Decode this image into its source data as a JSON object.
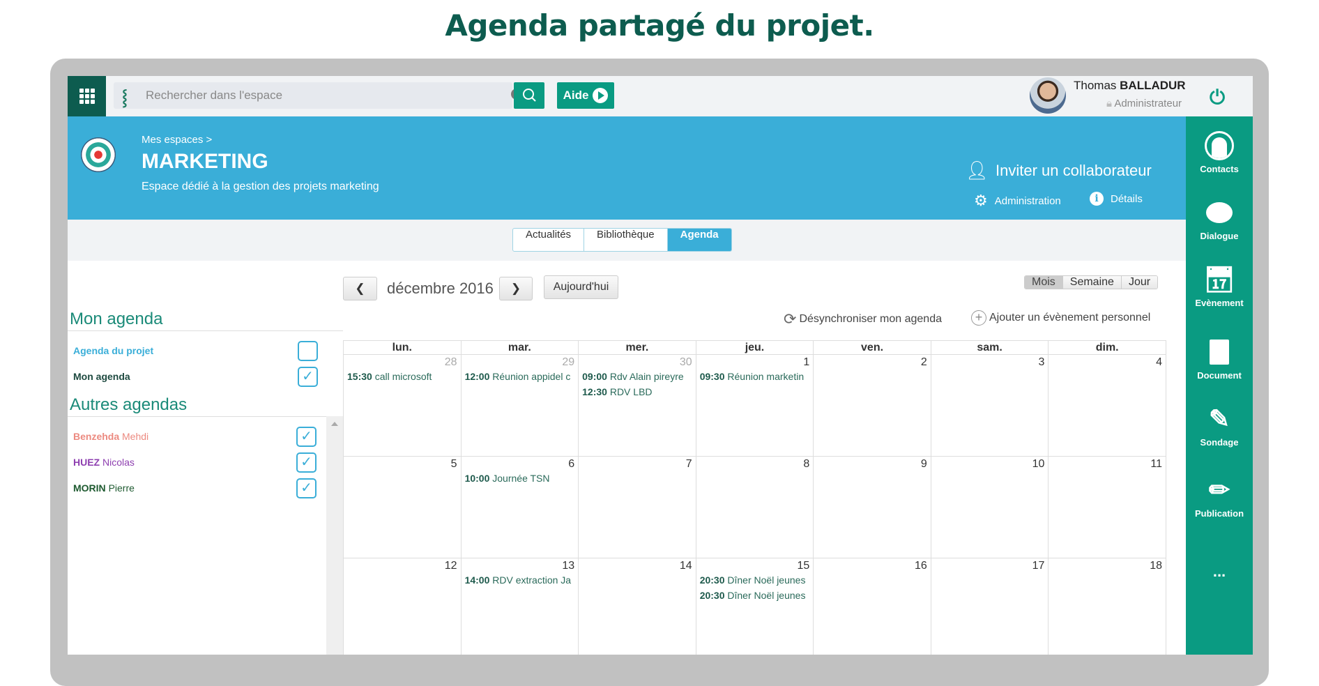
{
  "page_title": "Agenda partagé du projet.",
  "topbar": {
    "search_placeholder": "Rechercher dans l'espace",
    "help_label": "Aide",
    "user_first": "Thomas",
    "user_last": "BALLADUR",
    "user_role": "Administrateur"
  },
  "header": {
    "breadcrumb": "Mes espaces >",
    "space_name": "MARKETING",
    "space_desc": "Espace dédié à la gestion des projets marketing",
    "invite": "Inviter un collaborateur",
    "admin": "Administration",
    "details": "Détails"
  },
  "tabs": [
    {
      "label": "Actualités"
    },
    {
      "label": "Bibliothèque"
    },
    {
      "label": "Agenda",
      "active": true
    }
  ],
  "sidebar": [
    {
      "label": "Contacts",
      "icon": "user-circle-icon"
    },
    {
      "label": "Dialogue",
      "icon": "speech-bubble-icon"
    },
    {
      "label": "Evènement",
      "icon": "calendar-icon"
    },
    {
      "label": "Document",
      "icon": "document-icon"
    },
    {
      "label": "Sondage",
      "icon": "edit-icon"
    },
    {
      "label": "Publication",
      "icon": "pencil-icon"
    },
    {
      "label": "...",
      "icon": "more-icon"
    }
  ],
  "left": {
    "my_heading": "Mon agenda",
    "my": [
      {
        "label": "Agenda du projet",
        "checked": false,
        "color": "#3aaed8"
      },
      {
        "label": "Mon agenda",
        "checked": true,
        "color": "#1e4a40"
      }
    ],
    "others_heading": "Autres agendas",
    "others": [
      {
        "last": "Benzehda",
        "first": "Mehdi",
        "checked": true,
        "color": "#ec8a80"
      },
      {
        "last": "HUEZ",
        "first": "Nicolas",
        "checked": true,
        "color": "#8e3fb0"
      },
      {
        "last": "MORIN",
        "first": "Pierre",
        "checked": true,
        "color": "#1e5a30"
      }
    ]
  },
  "calendar": {
    "month": "décembre 2016",
    "today": "Aujourd'hui",
    "views": [
      {
        "label": "Mois",
        "active": true
      },
      {
        "label": "Semaine"
      },
      {
        "label": "Jour"
      }
    ],
    "unsync": "Désynchroniser mon agenda",
    "add_event": "Ajouter un évènement personnel",
    "weekdays": [
      "lun.",
      "mar.",
      "mer.",
      "jeu.",
      "ven.",
      "sam.",
      "dim."
    ],
    "weeks": [
      [
        {
          "d": "28",
          "o": true,
          "ev": [
            {
              "t": "15:30",
              "n": "call microsoft"
            }
          ]
        },
        {
          "d": "29",
          "o": true,
          "ev": [
            {
              "t": "12:00",
              "n": "Réunion appidel c"
            }
          ]
        },
        {
          "d": "30",
          "o": true,
          "ev": [
            {
              "t": "09:00",
              "n": "Rdv Alain pireyre"
            },
            {
              "t": "12:30",
              "n": "RDV LBD"
            }
          ]
        },
        {
          "d": "1",
          "ev": [
            {
              "t": "09:30",
              "n": "Réunion marketin"
            }
          ]
        },
        {
          "d": "2"
        },
        {
          "d": "3"
        },
        {
          "d": "4"
        }
      ],
      [
        {
          "d": "5"
        },
        {
          "d": "6",
          "ev": [
            {
              "t": "10:00",
              "n": "Journée TSN"
            }
          ]
        },
        {
          "d": "7"
        },
        {
          "d": "8"
        },
        {
          "d": "9"
        },
        {
          "d": "10"
        },
        {
          "d": "11"
        }
      ],
      [
        {
          "d": "12"
        },
        {
          "d": "13",
          "ev": [
            {
              "t": "14:00",
              "n": "RDV extraction Ja"
            }
          ]
        },
        {
          "d": "14"
        },
        {
          "d": "15",
          "ev": [
            {
              "t": "20:30",
              "n": "Dîner Noël jeunes"
            },
            {
              "t": "20:30",
              "n": "Dîner Noël jeunes"
            }
          ]
        },
        {
          "d": "16"
        },
        {
          "d": "17"
        },
        {
          "d": "18"
        }
      ]
    ]
  },
  "colors": {
    "brand_dark": "#0d5c4f",
    "brand": "#0a9b82",
    "header_blue": "#3aaed8"
  }
}
